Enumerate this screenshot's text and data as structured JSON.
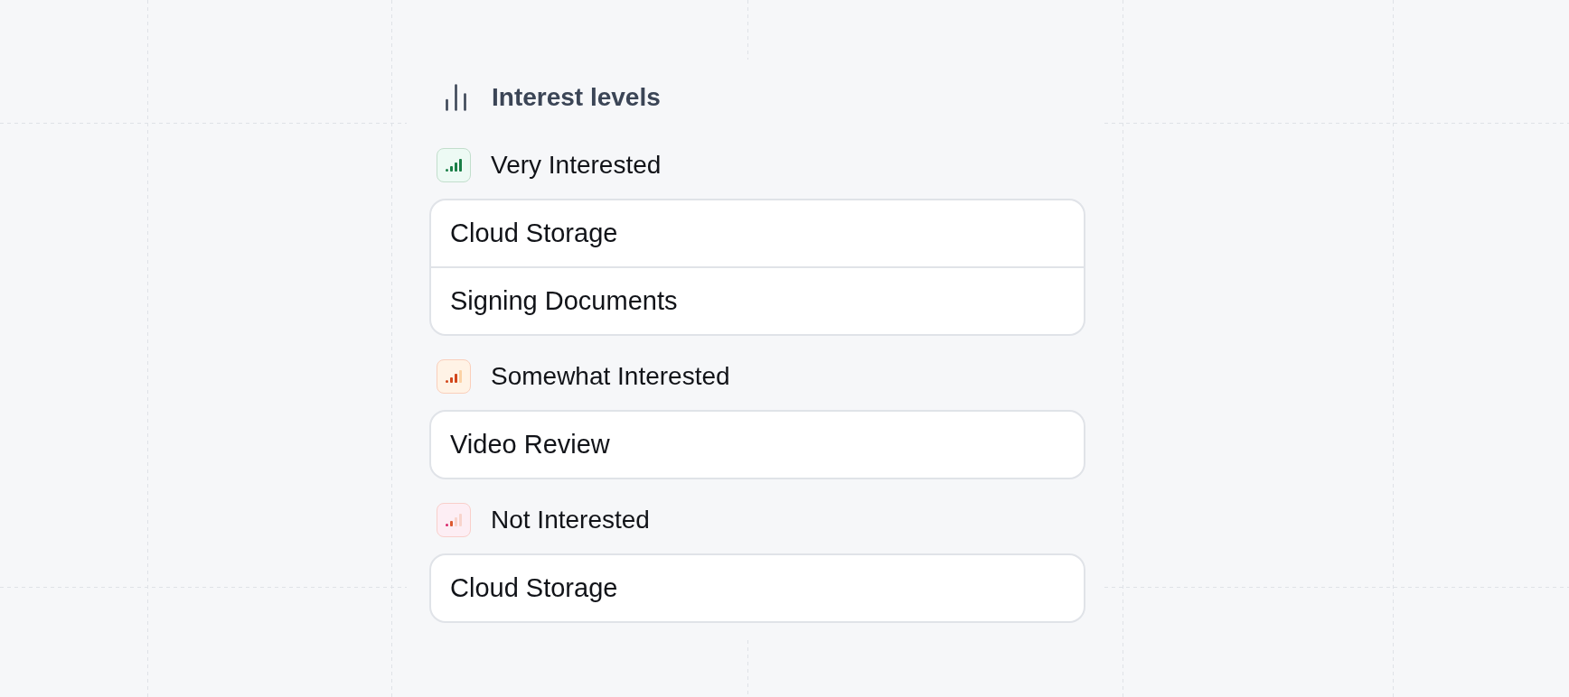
{
  "header": {
    "title": "Interest levels"
  },
  "groups": [
    {
      "label": "Very Interested",
      "kind": "high",
      "color": "#edfaf4",
      "items": [
        "Cloud Storage",
        "Signing Documents"
      ]
    },
    {
      "label": "Somewhat Interested",
      "kind": "medium",
      "color": "#fff3e6",
      "items": [
        "Video Review"
      ]
    },
    {
      "label": "Not Interested",
      "kind": "low",
      "color": "#fdeef4",
      "items": [
        "Cloud Storage"
      ]
    }
  ]
}
